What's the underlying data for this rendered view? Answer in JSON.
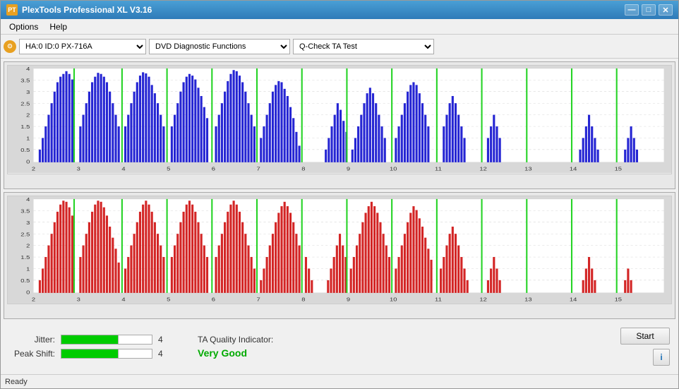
{
  "window": {
    "title": "PlexTools Professional XL V3.16",
    "title_icon": "PT"
  },
  "title_controls": {
    "minimize": "—",
    "maximize": "□",
    "close": "✕"
  },
  "menu": {
    "items": [
      "Options",
      "Help"
    ]
  },
  "toolbar": {
    "device_icon": "⊙",
    "device_label": "HA:0 ID:0  PX-716A",
    "function_label": "DVD Diagnostic Functions",
    "test_label": "Q-Check TA Test"
  },
  "chart_top": {
    "y_labels": [
      "4",
      "3.5",
      "3",
      "2.5",
      "2",
      "1.5",
      "1",
      "0.5",
      "0"
    ],
    "x_labels": [
      "2",
      "3",
      "4",
      "5",
      "6",
      "7",
      "8",
      "9",
      "10",
      "11",
      "12",
      "13",
      "14",
      "15"
    ],
    "color": "#0000cc"
  },
  "chart_bottom": {
    "y_labels": [
      "4",
      "3.5",
      "3",
      "2.5",
      "2",
      "1.5",
      "1",
      "0.5",
      "0"
    ],
    "x_labels": [
      "2",
      "3",
      "4",
      "5",
      "6",
      "7",
      "8",
      "9",
      "10",
      "11",
      "12",
      "13",
      "14",
      "15"
    ],
    "color": "#cc0000"
  },
  "metrics": {
    "jitter_label": "Jitter:",
    "jitter_value": "4",
    "jitter_filled": 5,
    "jitter_total": 8,
    "peak_shift_label": "Peak Shift:",
    "peak_shift_value": "4",
    "peak_shift_filled": 5,
    "peak_shift_total": 8
  },
  "quality": {
    "label": "TA Quality Indicator:",
    "value": "Very Good",
    "color": "#00aa00"
  },
  "actions": {
    "start_label": "Start",
    "info_label": "i"
  },
  "status": {
    "text": "Ready"
  }
}
